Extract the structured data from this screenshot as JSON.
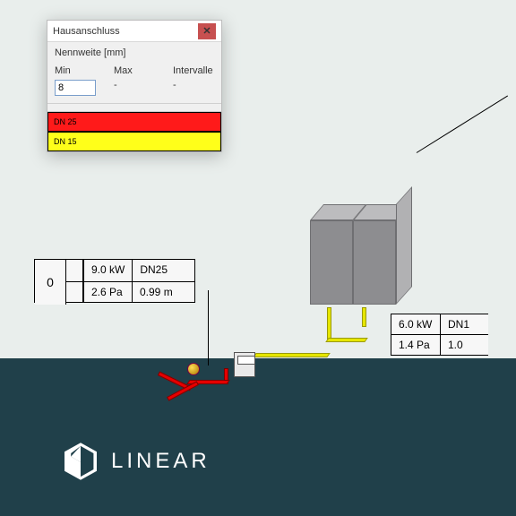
{
  "dialog": {
    "title": "Hausanschluss",
    "param_label": "Nennweite [mm]",
    "min_label": "Min",
    "max_label": "Max",
    "int_label": "Intervalle",
    "min_value": "8",
    "max_value": "-",
    "int_value": "-",
    "legend": [
      {
        "label": "DN 25",
        "color": "#ff1a1a"
      },
      {
        "label": "DN 15",
        "color": "#ffff1a"
      }
    ]
  },
  "callout_left": {
    "id": "0",
    "power": "9.0 kW",
    "dn": "DN25",
    "dp": "2.6 Pa",
    "len": "0.99 m"
  },
  "callout_right": {
    "power": "6.0 kW",
    "dn": "DN1",
    "dp": "1.4 Pa",
    "len": "1.0"
  },
  "brand": "LINEAR"
}
